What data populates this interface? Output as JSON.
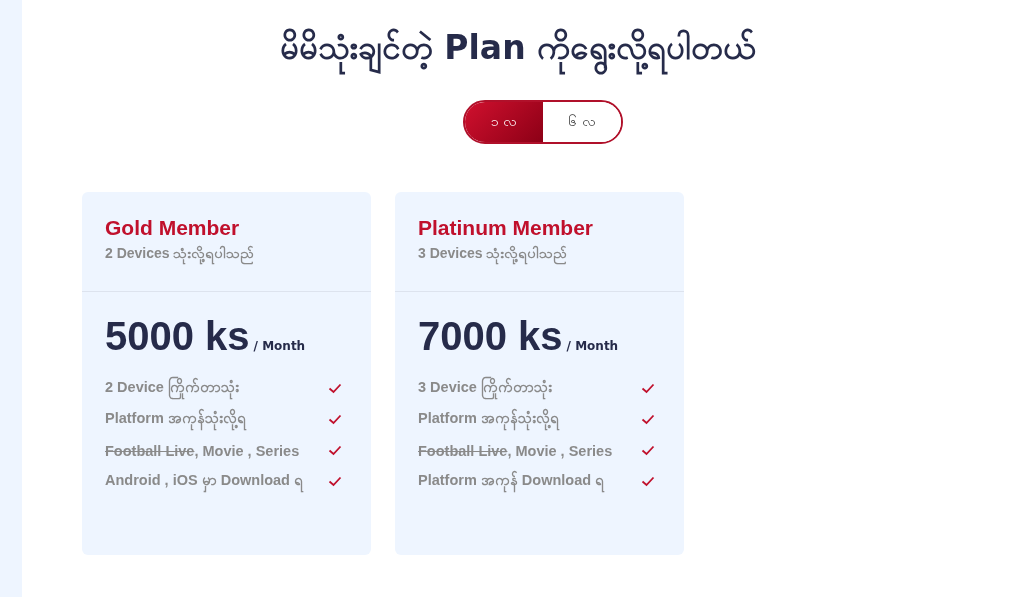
{
  "title": "မိမိသုံးချင်တဲ့ Plan ကိုရွေးလို့ရပါတယ်",
  "periods": [
    {
      "label": "၁ လ",
      "selected": true
    },
    {
      "label": "၆ လ",
      "selected": false
    }
  ],
  "plans": [
    {
      "name": "Gold Member",
      "devices": "2 Devices သုံးလို့ရပါသည်",
      "price": "5000 ks",
      "per": "/ Month",
      "features": [
        {
          "parts": [
            {
              "text": "2 Device ကြိုက်တာသုံး",
              "struck": false
            }
          ],
          "included": true
        },
        {
          "parts": [
            {
              "text": "Platform အကုန်သုံးလို့ရ",
              "struck": false
            }
          ],
          "included": true
        },
        {
          "parts": [
            {
              "text": "Football Live",
              "struck": true
            },
            {
              "text": ", Movie , Series",
              "struck": false
            }
          ],
          "included": true
        },
        {
          "parts": [
            {
              "text": "Android , iOS မှာ Download ရ",
              "struck": false
            }
          ],
          "included": true
        }
      ]
    },
    {
      "name": "Platinum Member",
      "devices": "3 Devices သုံးလို့ရပါသည်",
      "price": "7000 ks",
      "per": "/ Month",
      "features": [
        {
          "parts": [
            {
              "text": "3 Device ကြိုက်တာသုံး",
              "struck": false
            }
          ],
          "included": true
        },
        {
          "parts": [
            {
              "text": "Platform အကုန်သုံးလို့ရ",
              "struck": false
            }
          ],
          "included": true
        },
        {
          "parts": [
            {
              "text": "Football Live",
              "struck": true
            },
            {
              "text": ", Movie , Series",
              "struck": false
            }
          ],
          "included": true
        },
        {
          "parts": [
            {
              "text": "Platform အကုန် Download ရ",
              "struck": false
            }
          ],
          "included": true
        }
      ]
    }
  ]
}
